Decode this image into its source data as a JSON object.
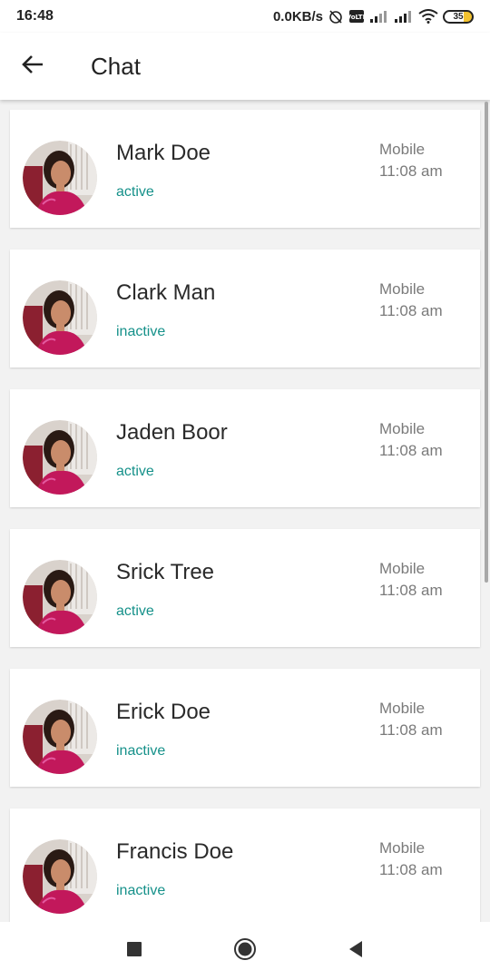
{
  "status_bar": {
    "time": "16:48",
    "network_speed": "0.0KB/s",
    "battery_level": "35"
  },
  "app_bar": {
    "title": "Chat",
    "back_icon": "arrow-back-icon"
  },
  "colors": {
    "status_accent": "#16918a",
    "secondary_text": "#7a7a7a"
  },
  "contacts": [
    {
      "name": "Mark Doe",
      "status": "active",
      "device": "Mobile",
      "time": "11:08 am"
    },
    {
      "name": "Clark Man",
      "status": "inactive",
      "device": "Mobile",
      "time": "11:08 am"
    },
    {
      "name": "Jaden Boor",
      "status": "active",
      "device": "Mobile",
      "time": "11:08 am"
    },
    {
      "name": "Srick Tree",
      "status": "active",
      "device": "Mobile",
      "time": "11:08 am"
    },
    {
      "name": "Erick Doe",
      "status": "inactive",
      "device": "Mobile",
      "time": "11:08 am"
    },
    {
      "name": "Francis Doe",
      "status": "inactive",
      "device": "Mobile",
      "time": "11:08 am"
    }
  ],
  "nav_bar": {
    "recents_icon": "square-icon",
    "home_icon": "circle-icon",
    "back_icon": "triangle-back-icon"
  }
}
